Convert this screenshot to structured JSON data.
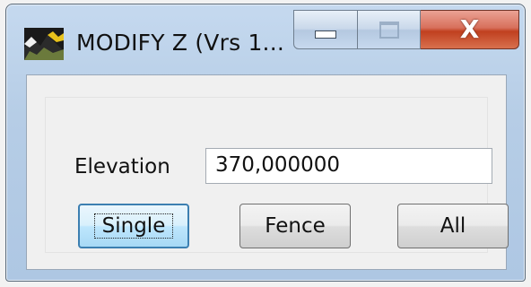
{
  "window": {
    "title": "MODIFY Z (Vrs 1...",
    "icon": "app-logo-icon",
    "controls": {
      "minimize_icon": "minimize-icon",
      "maximize_icon": "maximize-icon",
      "close_glyph": "X"
    }
  },
  "form": {
    "elevation_label": "Elevation",
    "elevation_value": "370,000000"
  },
  "buttons": {
    "single": "Single",
    "fence": "Fence",
    "all": "All"
  },
  "colors": {
    "frame": "#b6cde6",
    "close_button": "#c7482a",
    "focus_button": "#bee6fd"
  }
}
